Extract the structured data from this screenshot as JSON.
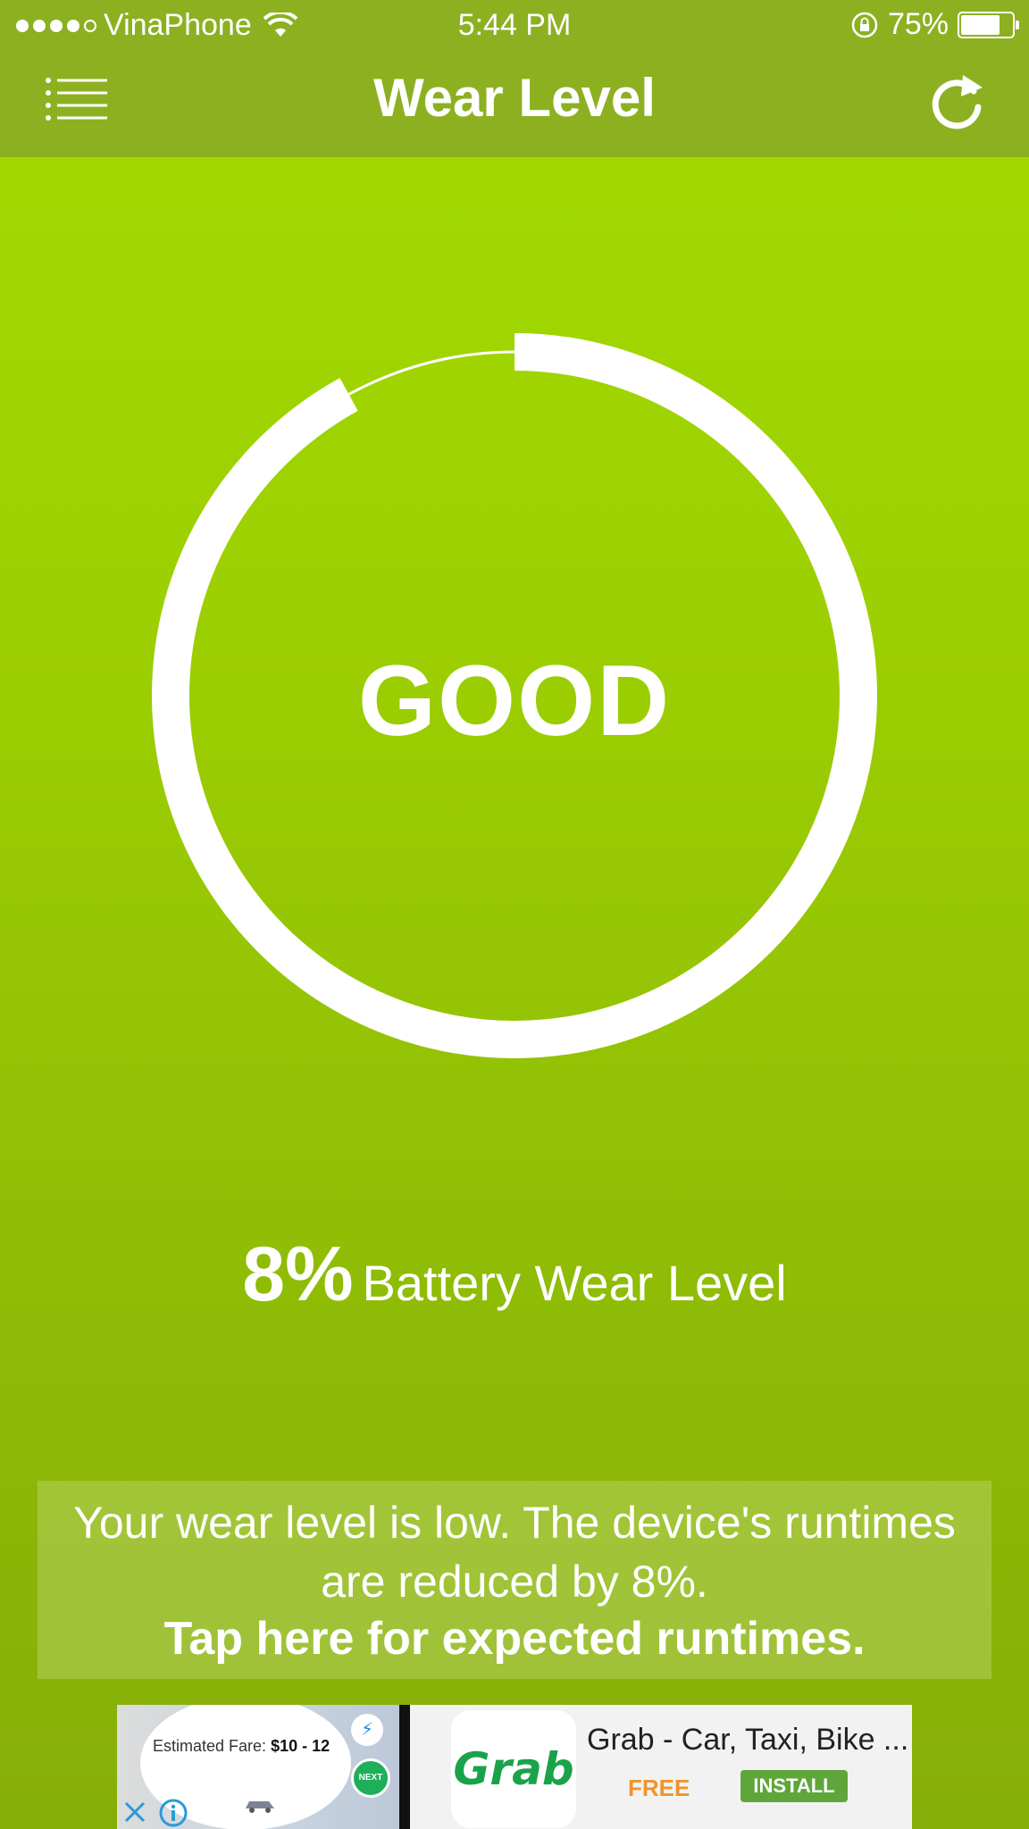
{
  "status_bar": {
    "carrier": "VinaPhone",
    "time": "5:44 PM",
    "battery_percent": "75%",
    "battery_level": 0.75,
    "signal_bars": 4
  },
  "nav": {
    "title": "Wear Level",
    "menu_icon": "list-menu-icon",
    "refresh_icon": "refresh-icon"
  },
  "gauge": {
    "status": "GOOD",
    "wear_fraction": 0.08,
    "ring_color": "#ffffff"
  },
  "wear": {
    "percent": "8%",
    "label": "Battery Wear Level"
  },
  "info": {
    "message_line1": "Your wear level is low. The device's runtimes",
    "message_line2": "are reduced by 8%.",
    "cta": "Tap here for expected runtimes."
  },
  "ad": {
    "fare_label": "Estimated Fare:",
    "fare_value": "$10 - 12",
    "next_label": "NEXT",
    "logo_text": "Grab",
    "title": "Grab - Car, Taxi, Bike ...",
    "price": "FREE",
    "install_label": "INSTALL"
  },
  "colors": {
    "nav_bar": "#8db021",
    "background_top": "#a3dc00",
    "background_bottom": "#86ae08",
    "install_button": "#5fa63a",
    "free_text": "#f0952a"
  }
}
